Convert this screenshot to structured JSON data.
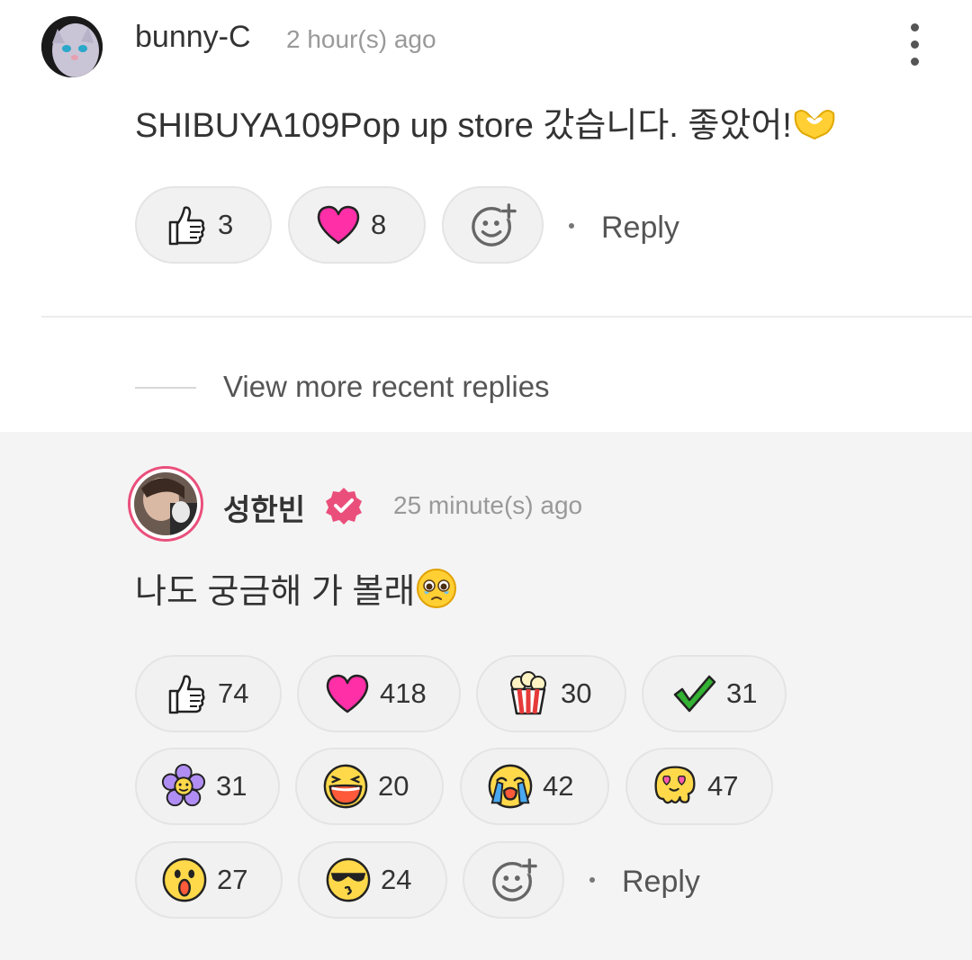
{
  "comment": {
    "author": "bunny-C",
    "time": "2 hour(s) ago",
    "text": "SHIBUYA109Pop up store 갔습니다. 좋았어!",
    "text_emoji": "heart-hands-emoji",
    "reactions": [
      {
        "icon": "thumbs-up-icon",
        "count": "3"
      },
      {
        "icon": "heart-icon",
        "count": "8"
      }
    ],
    "add_reaction_icon": "add-emoji-icon",
    "reply_label": "Reply"
  },
  "view_more": {
    "label": "View more recent replies"
  },
  "reply": {
    "author": "성한빈",
    "verified": true,
    "time": "25 minute(s) ago",
    "text": "나도 궁금해 가 볼래",
    "text_emoji": "pleading-face-emoji",
    "reactions": [
      {
        "icon": "thumbs-up-icon",
        "count": "74"
      },
      {
        "icon": "heart-icon",
        "count": "418"
      },
      {
        "icon": "popcorn-icon",
        "count": "30"
      },
      {
        "icon": "checkmark-icon",
        "count": "31"
      },
      {
        "icon": "flower-icon",
        "count": "31"
      },
      {
        "icon": "laughing-face-icon",
        "count": "20"
      },
      {
        "icon": "crying-face-icon",
        "count": "42"
      },
      {
        "icon": "melting-love-face-icon",
        "count": "47"
      },
      {
        "icon": "surprised-face-icon",
        "count": "27"
      },
      {
        "icon": "cool-kiss-face-icon",
        "count": "24"
      }
    ],
    "add_reaction_icon": "add-emoji-icon",
    "reply_label": "Reply"
  },
  "colors": {
    "accent_pink": "#ff2fa8",
    "verified_badge": "#ea4f7b",
    "reply_background": "#f4f4f4",
    "check_green": "#33b233",
    "emoji_yellow": "#ffd94a"
  }
}
